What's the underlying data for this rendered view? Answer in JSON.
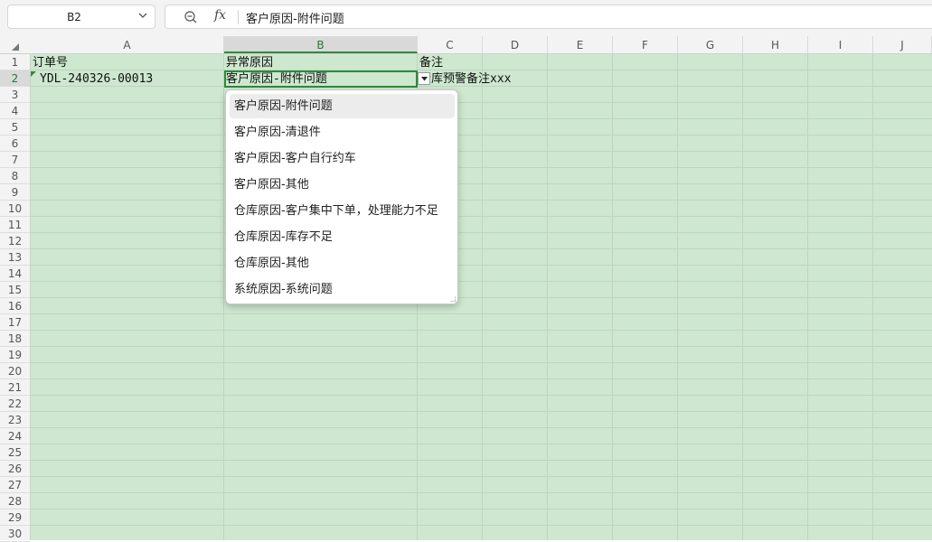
{
  "formula_bar": {
    "name_box": "B2",
    "fx_label": "fx",
    "formula": "客户原因-附件问题"
  },
  "columns": [
    "A",
    "B",
    "C",
    "D",
    "E",
    "F",
    "G",
    "H",
    "I",
    "J"
  ],
  "selected_column": "B",
  "rows": [
    "1",
    "2",
    "3",
    "4",
    "5",
    "6",
    "7",
    "8",
    "9",
    "10",
    "11",
    "12",
    "13",
    "14",
    "15",
    "16",
    "17",
    "18",
    "19",
    "20",
    "21",
    "22",
    "23",
    "24",
    "25",
    "26",
    "27",
    "28",
    "29",
    "30"
  ],
  "selected_row": "2",
  "cells": {
    "A1": "订单号",
    "B1": "异常原因",
    "C1": "备注",
    "A2": "YDL-240326-00013",
    "B2": "客户原因-附件问题",
    "C2": "仓库预警备注xxx"
  },
  "dropdown": {
    "items": [
      "客户原因-附件问题",
      "客户原因-清退件",
      "客户原因-客户自行约车",
      "客户原因-其他",
      "仓库原因-客户集中下单，处理能力不足",
      "仓库原因-库存不足",
      "仓库原因-其他",
      "系统原因-系统问题"
    ],
    "hovered_index": 0
  },
  "colors": {
    "sheet_background": "#cde8cf",
    "selection_border": "#2f8a3a"
  }
}
